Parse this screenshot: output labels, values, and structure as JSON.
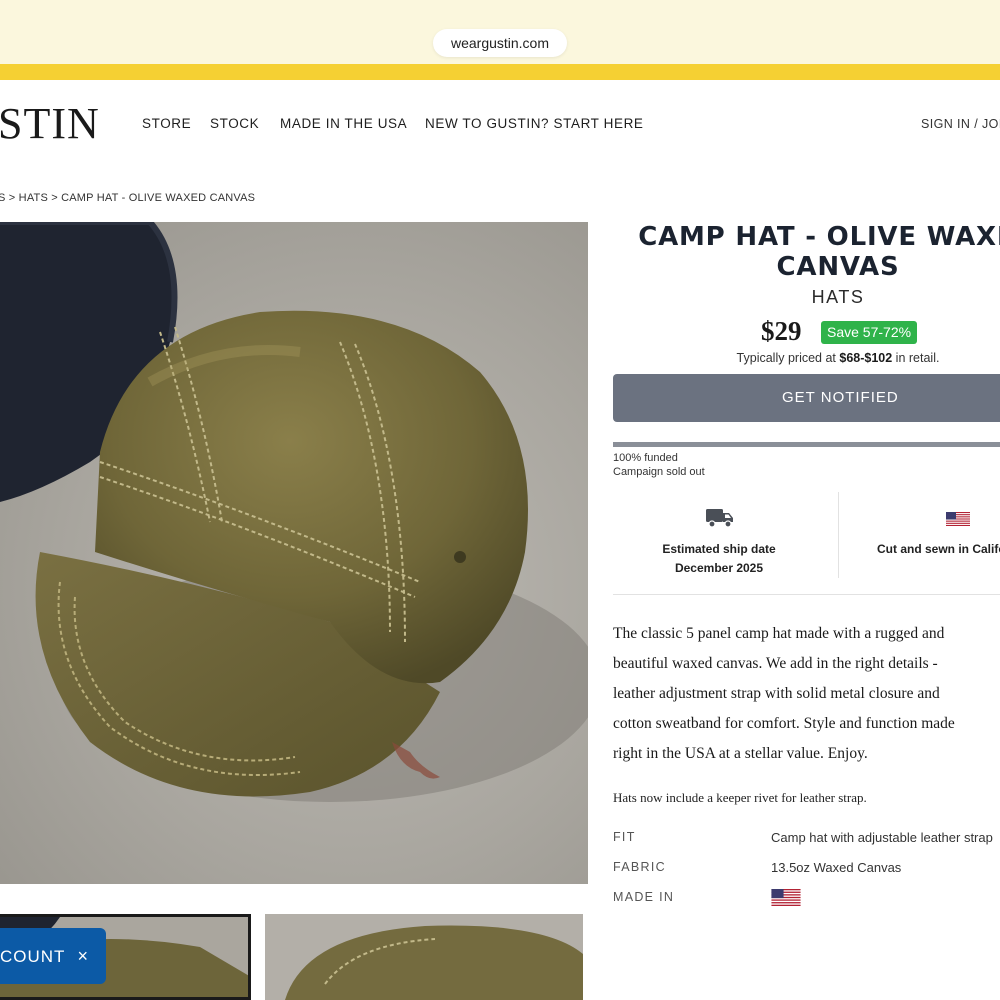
{
  "browser": {
    "url": "weargustin.com"
  },
  "header": {
    "logo": "STIN",
    "nav": [
      "STORE",
      "STOCK",
      "MADE IN THE USA",
      "NEW TO GUSTIN? START HERE"
    ],
    "account": "SIGN IN / JOIN"
  },
  "breadcrumb": "S > HATS > CAMP HAT - OLIVE WAXED CANVAS",
  "gallery": {
    "main_image": "olive-waxed-canvas-camp-hat-photo",
    "thumbnails": [
      "camp-hat-thumbnail-1",
      "camp-hat-thumbnail-2"
    ]
  },
  "discount_tab": {
    "label": "COUNT",
    "close": "×"
  },
  "product": {
    "title_line1": "CAMP HAT - OLIVE WAXED",
    "title_line2": "CANVAS",
    "category": "HATS",
    "price": "$29",
    "save_badge": "Save 57-72%",
    "retail_prefix": "Typically priced at ",
    "retail_range": "$68-$102",
    "retail_suffix": " in retail.",
    "cta": "GET NOTIFIED",
    "funded_fraction": 1.0,
    "funded_text": "100% funded",
    "campaign_status": "Campaign sold out",
    "ship_label": "Estimated ship date",
    "ship_date": "December 2025",
    "made_label": "Cut and sewn in California",
    "description_lines": [
      "The classic 5 panel camp hat made with a rugged and",
      "beautiful waxed canvas. We add in the right details -",
      "leather adjustment strap with solid metal closure and",
      "cotton sweatband for comfort. Style and function made",
      "right in the USA at a stellar value. Enjoy."
    ],
    "note": "Hats now include a keeper rivet for leather strap.",
    "specs": {
      "fit_label": "FIT",
      "fit_value": "Camp hat with adjustable leather strap",
      "fabric_label": "FABRIC",
      "fabric_value": "13.5oz Waxed Canvas",
      "made_in_label": "MADE IN",
      "made_in_value": "us-flag-icon"
    }
  },
  "colors": {
    "banner": "#fbf7dd",
    "stripe": "#f5d033",
    "save_badge": "#2fb34a",
    "cta": "#6b7280",
    "discount_tab": "#0c5aa6",
    "title": "#1b2330"
  }
}
